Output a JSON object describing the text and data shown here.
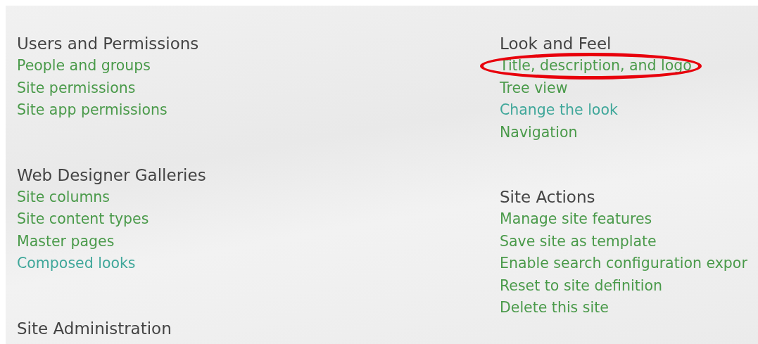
{
  "columns": [
    {
      "sections": [
        {
          "heading": "Users and Permissions",
          "links": [
            {
              "label": "People and groups",
              "visited": false,
              "highlighted": false
            },
            {
              "label": "Site permissions",
              "visited": false,
              "highlighted": false
            },
            {
              "label": "Site app permissions",
              "visited": false,
              "highlighted": false
            }
          ]
        },
        {
          "heading": "Web Designer Galleries",
          "links": [
            {
              "label": "Site columns",
              "visited": false,
              "highlighted": false
            },
            {
              "label": "Site content types",
              "visited": false,
              "highlighted": false
            },
            {
              "label": "Master pages",
              "visited": false,
              "highlighted": false
            },
            {
              "label": "Composed looks",
              "visited": true,
              "highlighted": false
            }
          ]
        },
        {
          "heading": "Site Administration"
        }
      ]
    },
    {
      "sections": [
        {
          "heading": "Look and Feel",
          "links": [
            {
              "label": "Title, description, and logo",
              "visited": false,
              "highlighted": true
            },
            {
              "label": "Tree view",
              "visited": false,
              "highlighted": false
            },
            {
              "label": "Change the look",
              "visited": true,
              "highlighted": false
            },
            {
              "label": "Navigation",
              "visited": false,
              "highlighted": false
            }
          ]
        },
        {
          "heading": "Site Actions",
          "links": [
            {
              "label": "Manage site features",
              "visited": false,
              "highlighted": false
            },
            {
              "label": "Save site as template",
              "visited": false,
              "highlighted": false
            },
            {
              "label": "Enable search configuration expor",
              "visited": false,
              "highlighted": false
            },
            {
              "label": "Reset to site definition",
              "visited": false,
              "highlighted": false
            },
            {
              "label": "Delete this site",
              "visited": false,
              "highlighted": false
            }
          ]
        }
      ]
    }
  ]
}
